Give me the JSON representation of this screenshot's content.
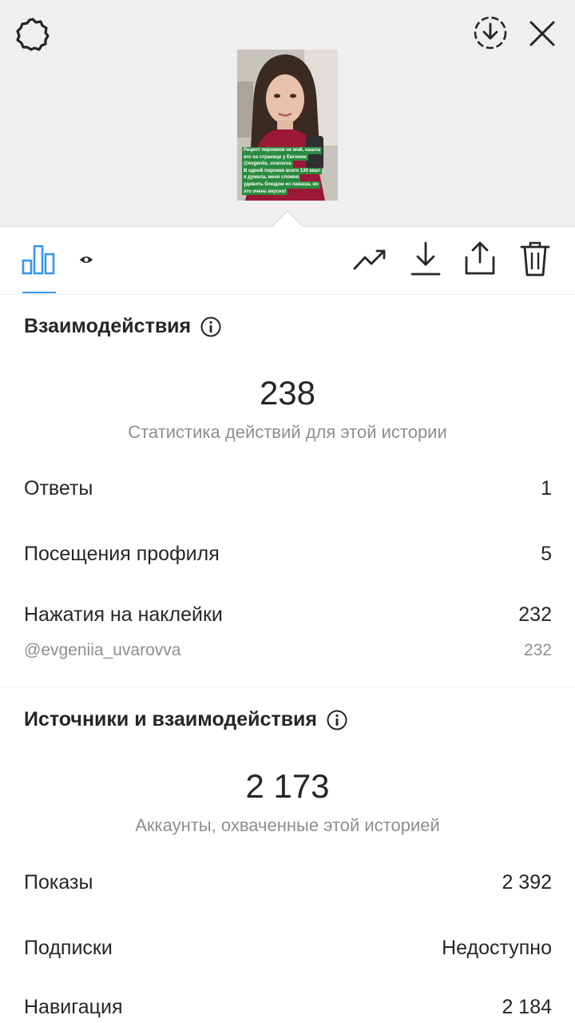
{
  "top_bar": {
    "settings_icon": "settings-gear-icon",
    "save_icon": "download-circle-icon",
    "close_icon": "close-icon"
  },
  "story_thumbnail": {
    "lines": [
      "Рецепт пирожков не мой, нашла",
      "его на странице у Евгении",
      "@evgeniia_uvarovva",
      "В одной пирожке всего 130 ккал",
      "я думала, меня сложно",
      "удивить блюдом из лаваша, но",
      "это очень вкусно!"
    ]
  },
  "toolbar": {
    "tabs": [
      "insights-bar-chart-icon",
      "viewers-eye-icon"
    ],
    "actions": [
      "trend-icon",
      "download-icon",
      "share-icon",
      "trash-icon"
    ],
    "accent": "#3897f0"
  },
  "interactions": {
    "title": "Взаимодействия",
    "total": "238",
    "caption": "Статистика действий для этой истории",
    "rows": [
      {
        "label": "Ответы",
        "value": "1"
      },
      {
        "label": "Посещения профиля",
        "value": "5"
      },
      {
        "label": "Нажатия на наклейки",
        "value": "232"
      }
    ],
    "sub_row": {
      "label": "@evgeniia_uvarovva",
      "value": "232"
    }
  },
  "discovery": {
    "title": "Источники и взаимодействия",
    "total": "2 173",
    "caption": "Аккаунты, охваченные этой историей",
    "rows": [
      {
        "label": "Показы",
        "value": "2 392"
      },
      {
        "label": "Подписки",
        "value": "Недоступно"
      },
      {
        "label": "Навигация",
        "value": "2 184"
      }
    ]
  }
}
